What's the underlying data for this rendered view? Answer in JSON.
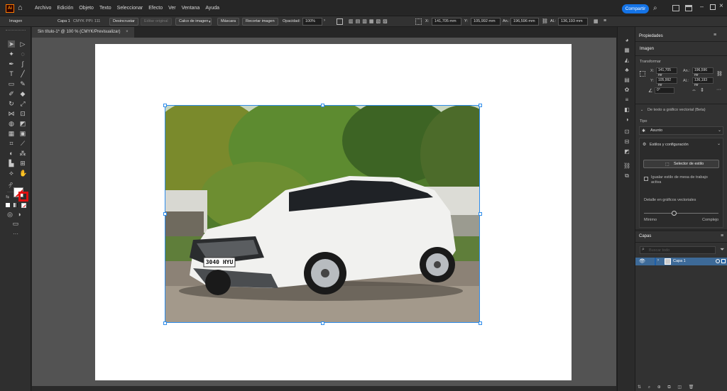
{
  "app": {
    "logo": "Ai"
  },
  "menu": [
    "Archivo",
    "Edición",
    "Objeto",
    "Texto",
    "Seleccionar",
    "Efecto",
    "Ver",
    "Ventana",
    "Ayuda"
  ],
  "share_label": "Compartir",
  "control": {
    "object_type": "Imagen",
    "layer": "Capa 1",
    "color_mode": "CMYK",
    "ppi": "PPI: 111",
    "unembed": "Desincrustar",
    "edit_original": "Editar original",
    "image_trace": "Calco de imagen",
    "mask": "Máscara",
    "crop": "Recortar imagen",
    "opacity_label": "Opacidad:",
    "opacity": "100%",
    "x_label": "X:",
    "x": "141,705 mm",
    "y_label": "Y:",
    "y": "105,992 mm",
    "w_label": "An.:",
    "w": "196,596 mm",
    "h_label": "Al.:",
    "h": "136,193 mm"
  },
  "document_tab": "Sin título-1* @ 100 % (CMYK/Previsualizar)",
  "photo": {
    "plate": "3040 HYU"
  },
  "properties": {
    "tab": "Propiedades",
    "section": "Imagen",
    "transform_title": "Transformar",
    "x_label": "X:",
    "x": "141,705 mr",
    "y_label": "Y:",
    "y": "105,992 mr",
    "w_label": "An.:",
    "w": "196,596 mr",
    "h_label": "Al.:",
    "h": "136,193 mr",
    "angle": "0°",
    "trace_title": "De texto a gráfico vectorial (Beta)",
    "type_label": "Tipo",
    "type_value": "Asunto",
    "styles_label": "Estilos y configuración",
    "style_selector": "Selector de estilo",
    "match_label": "Igualar estilo de mesa de trabajo activa",
    "detail_label": "Detalle en gráficos vectoriales",
    "slider_min": "Mínimo",
    "slider_max": "Complejo",
    "detail_level": 0.4
  },
  "layers": {
    "tab": "Capas",
    "search_placeholder": "Buscar todo",
    "items": [
      {
        "name": "Capa 1"
      }
    ]
  },
  "colors": {
    "accent": "#1473e6",
    "selection": "#2d8ceb"
  }
}
